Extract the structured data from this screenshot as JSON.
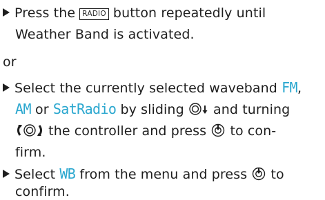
{
  "steps": [
    {
      "line1_before": "Press the",
      "key_label": "RADIO",
      "line1_after": "button repeatedly until",
      "line2": "Weather Band is activated."
    },
    {
      "line1_before": "Select the currently selected waveband",
      "band_fm": "FM",
      "comma": ",",
      "band_am": "AM",
      "word_or": "or",
      "band_sat": "SatRadio",
      "by_sliding": "by sliding",
      "and_turning": "and turning",
      "line3_after": "the controller and press",
      "line3_end": "to con-",
      "line4": "firm."
    },
    {
      "select": "Select",
      "band_wb": "WB",
      "line1_after": "from the menu and press",
      "line1_end": "to",
      "line2": "confirm."
    }
  ],
  "separator": "or",
  "icons": [
    "bullet-triangle-icon",
    "controller-slide-down-icon",
    "controller-turn-icon",
    "controller-press-icon"
  ]
}
